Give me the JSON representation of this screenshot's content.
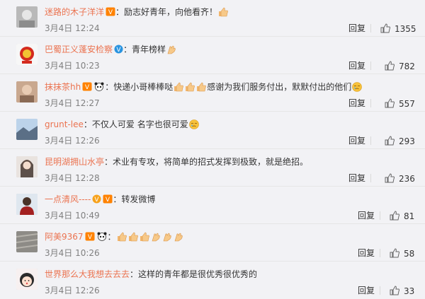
{
  "colors": {
    "username": "#eb7350",
    "meta": "#808080",
    "bg": "#f2f2f5"
  },
  "reply_label": "回复",
  "comments": [
    {
      "user": "迷路的木子洋洋",
      "badges": [
        "vip-icon"
      ],
      "text": "：励志好青年，向他看齐！",
      "emojis": [
        "thumbs-up-emoji"
      ],
      "time": "3月4日 12:24",
      "likes": "1355",
      "avatar": "grey-photo"
    },
    {
      "user": "巴蜀正义蓬安检察",
      "badges": [
        "verified-blue-icon"
      ],
      "text": "：青年榜样",
      "emojis": [
        "clap-emoji"
      ],
      "time": "3月4日 10:23",
      "likes": "782",
      "avatar": "emblem"
    },
    {
      "user": "抹抹茶hh",
      "badges": [
        "vip-icon",
        "panda-icon"
      ],
      "text": "：快递小哥棒棒哒",
      "text2": "感谢为我们服务付出，默默付出的他们",
      "emojis": [
        "thumbs-up-emoji",
        "thumbs-up-emoji",
        "thumbs-up-emoji"
      ],
      "emojis2": [
        "cry-emoji"
      ],
      "time": "3月4日 12:27",
      "likes": "557",
      "avatar": "portrait"
    },
    {
      "user": "grunt-lee",
      "badges": [],
      "text": "：不仅人可爱 名字也很可爱",
      "emojis": [
        "cry-emoji"
      ],
      "time": "3月4日 12:26",
      "likes": "293",
      "avatar": "landscape"
    },
    {
      "user": "昆明湖拥山水亭",
      "badges": [],
      "text": "：术业有专攻，将简单的招式发挥到极致，就是绝招。",
      "emojis": [],
      "time": "3月4日 12:28",
      "likes": "236",
      "avatar": "girl"
    },
    {
      "user": "一点清风----",
      "badges": [
        "verified-yellow-icon",
        "vip-icon"
      ],
      "text": "：转发微博",
      "emojis": [],
      "time": "3月4日 10:49",
      "likes": "81",
      "avatar": "man"
    },
    {
      "user": "阿美9367",
      "badges": [
        "vip-icon",
        "panda-icon"
      ],
      "text": "：",
      "emojis": [
        "thumbs-up-emoji",
        "thumbs-up-emoji",
        "thumbs-up-emoji",
        "clap-emoji",
        "clap-emoji",
        "clap-emoji"
      ],
      "time": "3月4日 10:26",
      "likes": "58",
      "avatar": "pattern"
    },
    {
      "user": "世界那么大我想去去去",
      "badges": [],
      "text": "：这样的青年都是很优秀很优秀的",
      "emojis": [],
      "time": "3月4日 12:26",
      "likes": "33",
      "avatar": "cartoon"
    }
  ]
}
